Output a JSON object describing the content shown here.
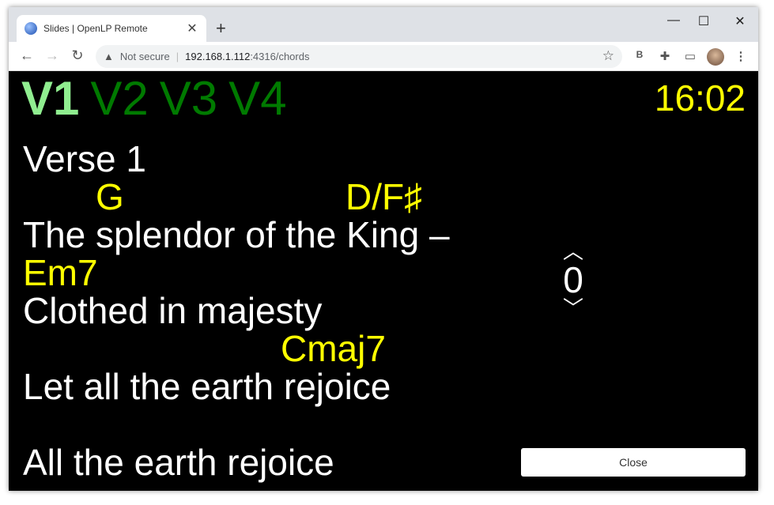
{
  "browser": {
    "tab_title": "Slides | OpenLP Remote",
    "tab_close": "✕",
    "new_tab": "+",
    "window_controls": {
      "minimize": "—",
      "maximize": "☐",
      "close": "✕"
    },
    "nav": {
      "back": "←",
      "forward": "→",
      "reload": "↻"
    },
    "address": {
      "security_label": "Not secure",
      "separator": "|",
      "host": "192.168.1.112",
      "path": ":4316/chords"
    },
    "icons": [
      "bookmark-star-icon",
      "extension-b-icon",
      "puzzle-extensions-icon",
      "cast-icon",
      "profile-avatar",
      "kebab-menu-icon"
    ]
  },
  "slide": {
    "verse_tags": [
      "V1",
      "V2",
      "V3",
      "V4"
    ],
    "active_tag": "V1",
    "clock": "16:02",
    "heading": "Verse 1",
    "lines": [
      {
        "type": "chords",
        "chords": [
          {
            "name": "G",
            "offset": 92
          },
          {
            "name": "D/F♯",
            "offset": 408
          }
        ]
      },
      {
        "type": "lyric",
        "text": "The splendor of the King –"
      },
      {
        "type": "chords",
        "chords": [
          {
            "name": "Em7",
            "offset": 0
          }
        ]
      },
      {
        "type": "lyric",
        "text": "Clothed in majesty"
      },
      {
        "type": "chords",
        "chords": [
          {
            "name": "Cmaj7",
            "offset": 326
          }
        ]
      },
      {
        "type": "lyric",
        "text": "Let all the earth rejoice"
      },
      {
        "type": "blank",
        "text": ""
      },
      {
        "type": "lyric",
        "text": "All the earth rejoice"
      }
    ],
    "transpose": {
      "up": "^",
      "value": "0",
      "down": "v"
    },
    "close_label": "Close"
  },
  "colors": {
    "active_tag": "#90ee90",
    "inactive_tag": "#007a00",
    "chord": "#ffff00",
    "lyric": "#ffffff",
    "background": "#000000"
  }
}
